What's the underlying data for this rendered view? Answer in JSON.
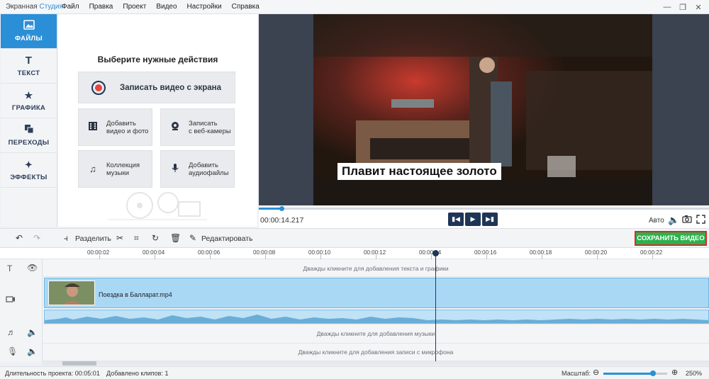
{
  "app": {
    "title_part1": "Экранная ",
    "title_part2": "Студия",
    "accent_color": "#2a8fd6"
  },
  "menu": [
    "Файл",
    "Правка",
    "Проект",
    "Видео",
    "Настройки",
    "Справка"
  ],
  "window_controls": {
    "minimize_icon": "minimize-icon",
    "restore_icon": "restore-icon",
    "close_icon": "close-icon"
  },
  "sidebar": {
    "items": [
      {
        "label": "ФАЙЛЫ",
        "icon": "image-icon",
        "active": true
      },
      {
        "label": "ТЕКСТ",
        "icon": "text-icon",
        "active": false
      },
      {
        "label": "ГРАФИКА",
        "icon": "star-icon",
        "active": false
      },
      {
        "label": "ПЕРЕХОДЫ",
        "icon": "transitions-icon",
        "active": false
      },
      {
        "label": "ЭФФЕКТЫ",
        "icon": "magic-wand-icon",
        "active": false
      }
    ]
  },
  "actions": {
    "title": "Выберите нужные действия",
    "record_screen": "Записать видео с экрана",
    "add_video": "Добавить\nвидео и фото",
    "record_webcam": "Записать\nс веб-камеры",
    "music_collection": "Коллекция\nмузыки",
    "add_audio": "Добавить\nаудиофайлы"
  },
  "preview": {
    "subtitle": "Плавит настоящее золото",
    "timecode": "00:00:14.217",
    "progress_fraction": 0.05,
    "quality": "Авто"
  },
  "toolbar": {
    "split": "Разделить",
    "edit": "Редактировать",
    "save": "СОХРАНИТЬ ВИДЕО",
    "save_color": "#2bb24c"
  },
  "ruler": {
    "ticks": [
      "00:00:02",
      "00:00:04",
      "00:00:06",
      "00:00:08",
      "00:00:10",
      "00:00:12",
      "00:00:14",
      "00:00:16",
      "00:00:18",
      "00:00:20",
      "00:00:22"
    ]
  },
  "timeline": {
    "text_hint": "Дважды кликните для добавления текста и графики",
    "clip_name": "Поездка в Балларат.mp4",
    "music_hint": "Дважды кликните для добавления музыки",
    "mic_hint": "Дважды кликните для добавления записи с микрофона"
  },
  "status": {
    "duration": "Длительность проекта: 00:05:01",
    "clips": "Добавлено клипов: 1",
    "zoom_label": "Масштаб:",
    "zoom_value": "250%",
    "zoom_fraction": 0.78
  }
}
